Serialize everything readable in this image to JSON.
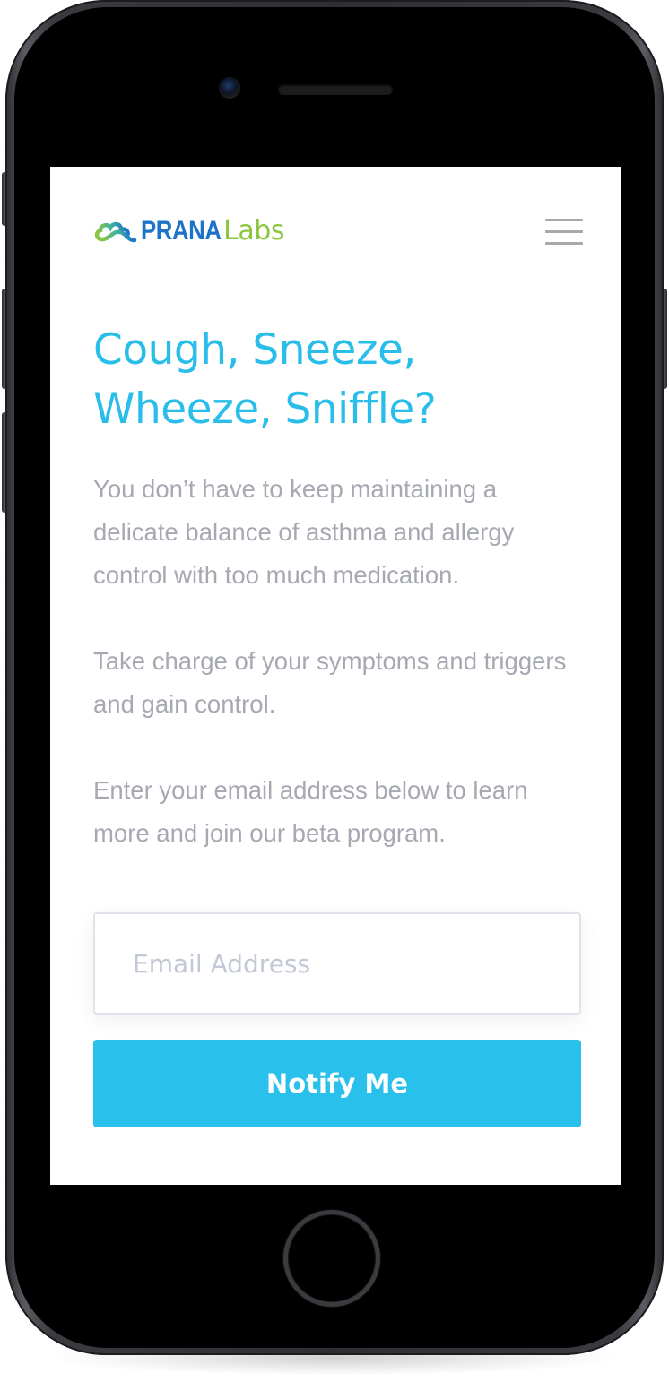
{
  "brand": {
    "name_part1": "PRANA",
    "name_part2": "Labs",
    "primary_color": "#1d73c8",
    "secondary_color": "#8cc63f",
    "logo_icon": "cloud-icon"
  },
  "header": {
    "menu_icon": "hamburger-menu-icon"
  },
  "hero": {
    "headline_line1": "Cough, Sneeze,",
    "headline_line2": "Wheeze, Sniffle?",
    "headline_color": "#29bdea"
  },
  "body": {
    "paragraph1": "You don’t have to keep maintaining a delicate balance of asthma and allergy control with too much medication.",
    "paragraph2": "Take charge of your symptoms and triggers and gain control.",
    "paragraph3": "Enter your email address below to learn more and join our beta program."
  },
  "signup": {
    "email_placeholder": "Email Address",
    "email_value": "",
    "button_label": "Notify Me",
    "button_color": "#29c1ec"
  }
}
